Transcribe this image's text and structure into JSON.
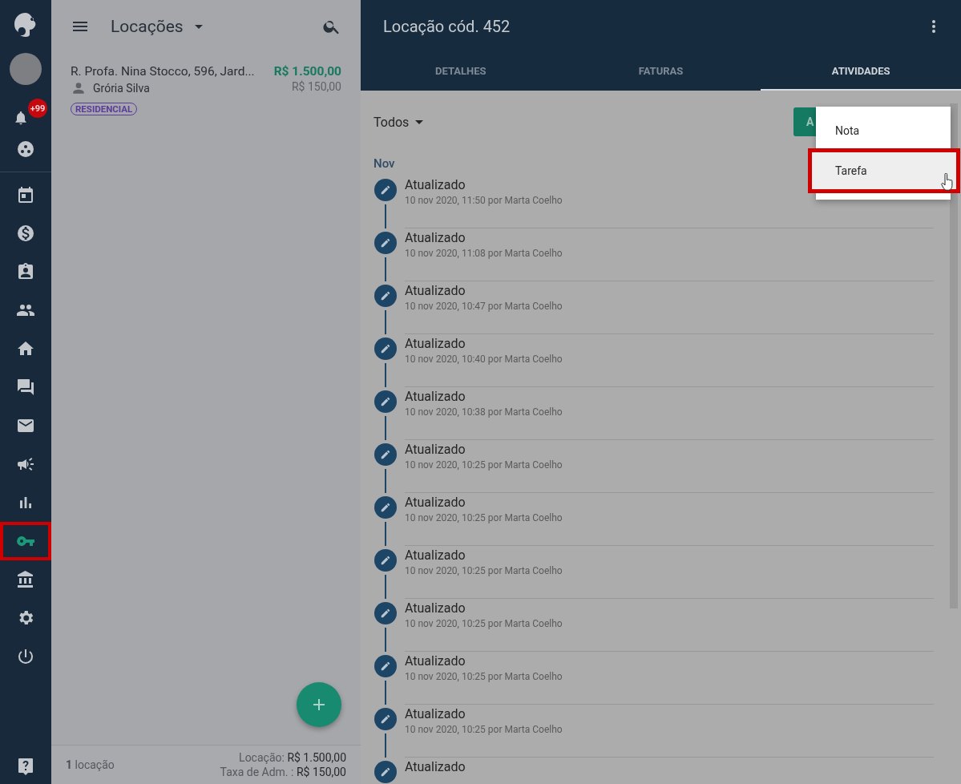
{
  "sidebar": {
    "items": [
      {
        "kind": "calendar",
        "selected": false,
        "highlighted": false
      },
      {
        "kind": "dollar",
        "selected": false,
        "highlighted": false
      },
      {
        "kind": "contact",
        "selected": false,
        "highlighted": false
      },
      {
        "kind": "people",
        "selected": false,
        "highlighted": false
      },
      {
        "kind": "home",
        "selected": false,
        "highlighted": false
      },
      {
        "kind": "chat",
        "selected": false,
        "highlighted": false
      },
      {
        "kind": "mail",
        "selected": false,
        "highlighted": false
      },
      {
        "kind": "megaphone",
        "selected": false,
        "highlighted": false
      },
      {
        "kind": "chart",
        "selected": false,
        "highlighted": false
      },
      {
        "kind": "key",
        "selected": true,
        "highlighted": true
      },
      {
        "kind": "bank",
        "selected": false,
        "highlighted": false
      },
      {
        "kind": "gear",
        "selected": false,
        "highlighted": false
      },
      {
        "kind": "power",
        "selected": false,
        "highlighted": false
      }
    ],
    "notification_badge": "+99"
  },
  "list_panel": {
    "title": "Locações",
    "items": [
      {
        "address": "R. Profa. Nina Stocco, 596, Jard...",
        "person": "Grória Silva",
        "rent": "R$ 1.500,00",
        "fee": "R$ 150,00",
        "tag": "RESIDENCIAL"
      }
    ],
    "footer": {
      "count": "1",
      "count_label": "locação",
      "rent_label": "Locação:",
      "rent": "R$ 1.500,00",
      "fee_label": "Taxa de Adm. :",
      "fee": "R$ 150,00"
    }
  },
  "detail": {
    "title": "Locação cód. 452",
    "tabs": [
      {
        "label": "DETALHES",
        "selected": false
      },
      {
        "label": "FATURAS",
        "selected": false
      },
      {
        "label": "ATIVIDADES",
        "selected": true
      }
    ],
    "filter": "Todos",
    "add_button": "A",
    "month": "Nov",
    "activities": [
      {
        "title": "Atualizado",
        "meta": "10 nov 2020, 11:50 por Marta Coelho"
      },
      {
        "title": "Atualizado",
        "meta": "10 nov 2020, 11:08 por Marta Coelho"
      },
      {
        "title": "Atualizado",
        "meta": "10 nov 2020, 10:47 por Marta Coelho"
      },
      {
        "title": "Atualizado",
        "meta": "10 nov 2020, 10:40 por Marta Coelho"
      },
      {
        "title": "Atualizado",
        "meta": "10 nov 2020, 10:38 por Marta Coelho"
      },
      {
        "title": "Atualizado",
        "meta": "10 nov 2020, 10:25 por Marta Coelho"
      },
      {
        "title": "Atualizado",
        "meta": "10 nov 2020, 10:25 por Marta Coelho"
      },
      {
        "title": "Atualizado",
        "meta": "10 nov 2020, 10:25 por Marta Coelho"
      },
      {
        "title": "Atualizado",
        "meta": "10 nov 2020, 10:25 por Marta Coelho"
      },
      {
        "title": "Atualizado",
        "meta": "10 nov 2020, 10:25 por Marta Coelho"
      },
      {
        "title": "Atualizado",
        "meta": "10 nov 2020, 10:25 por Marta Coelho"
      },
      {
        "title": "Atualizado"
      }
    ],
    "menu": [
      {
        "label": "Nota",
        "selected": false,
        "highlighted": false
      },
      {
        "label": "Tarefa",
        "selected": true,
        "highlighted": true
      }
    ]
  }
}
